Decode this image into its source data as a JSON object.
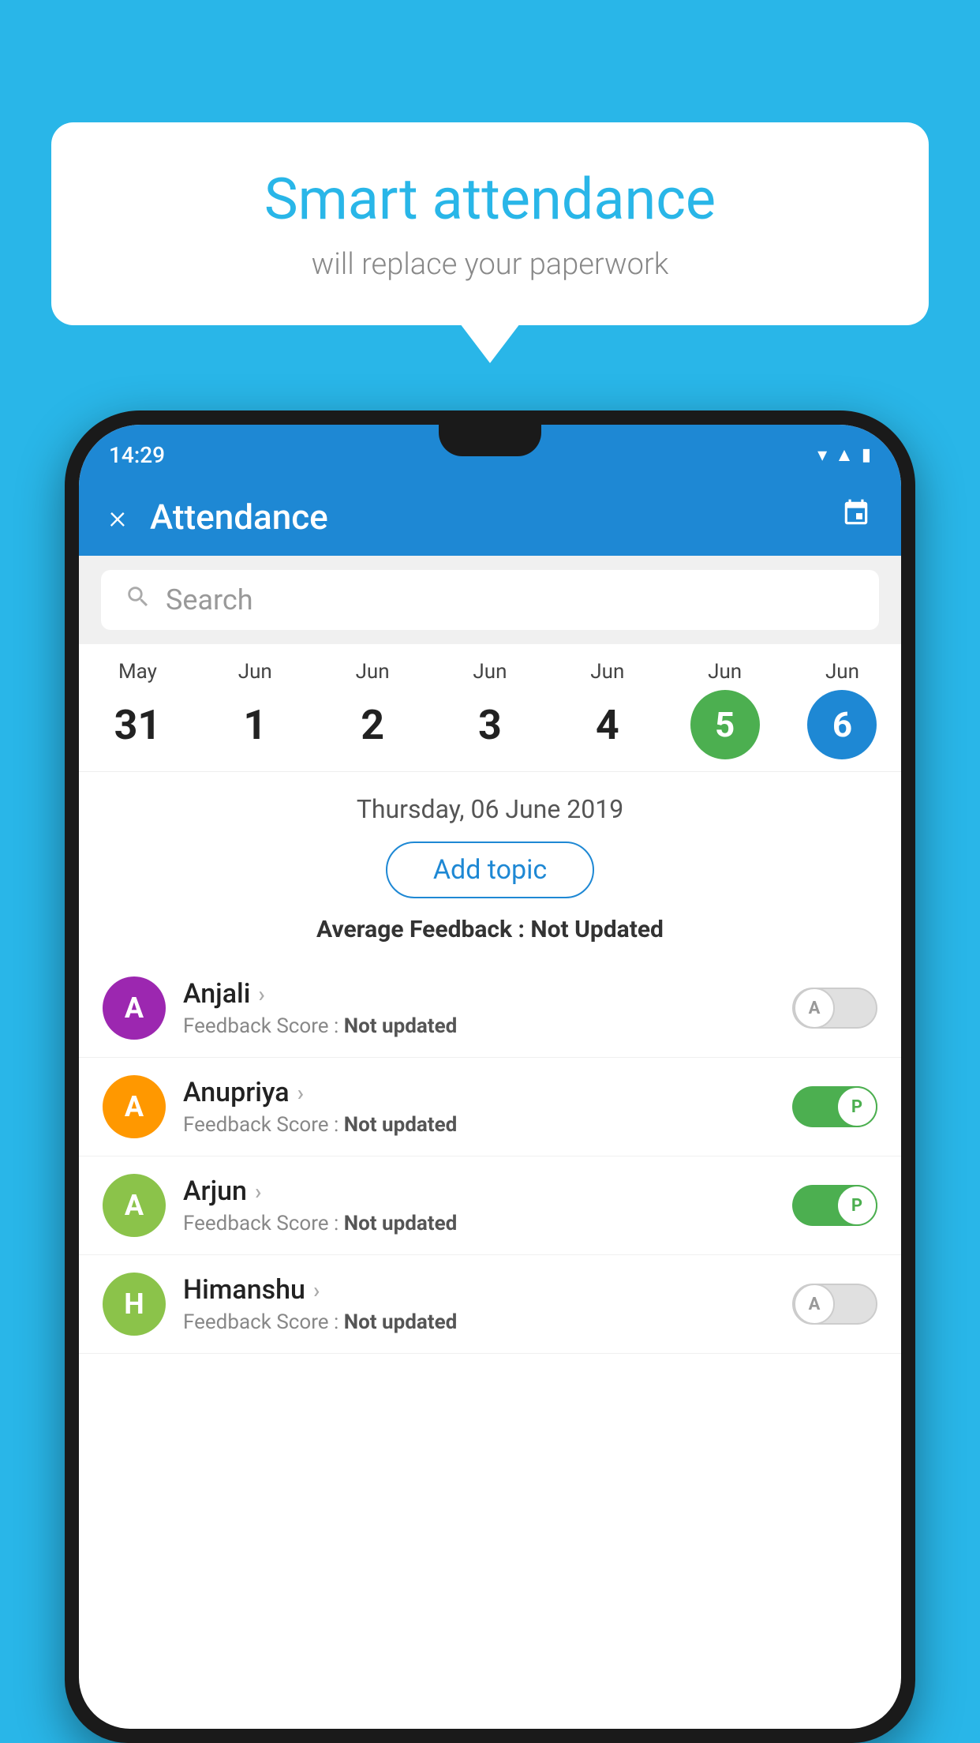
{
  "background": {
    "color": "#29b6e8"
  },
  "speech_bubble": {
    "title": "Smart attendance",
    "subtitle": "will replace your paperwork"
  },
  "status_bar": {
    "time": "14:29",
    "icons": [
      "wifi",
      "signal",
      "battery"
    ]
  },
  "app_bar": {
    "title": "Attendance",
    "close_label": "×",
    "calendar_icon": "📅"
  },
  "search": {
    "placeholder": "Search"
  },
  "calendar": {
    "days": [
      {
        "month": "May",
        "day": "31",
        "state": "normal"
      },
      {
        "month": "Jun",
        "day": "1",
        "state": "normal"
      },
      {
        "month": "Jun",
        "day": "2",
        "state": "normal"
      },
      {
        "month": "Jun",
        "day": "3",
        "state": "normal"
      },
      {
        "month": "Jun",
        "day": "4",
        "state": "normal"
      },
      {
        "month": "Jun",
        "day": "5",
        "state": "today"
      },
      {
        "month": "Jun",
        "day": "6",
        "state": "selected"
      }
    ]
  },
  "date_info": {
    "label": "Thursday, 06 June 2019",
    "add_topic_button": "Add topic",
    "avg_feedback_label": "Average Feedback : ",
    "avg_feedback_value": "Not Updated"
  },
  "students": [
    {
      "name": "Anjali",
      "avatar_letter": "A",
      "avatar_color": "purple",
      "feedback": "Feedback Score : ",
      "feedback_value": "Not updated",
      "status": "absent",
      "toggle_letter": "A"
    },
    {
      "name": "Anupriya",
      "avatar_letter": "A",
      "avatar_color": "orange",
      "feedback": "Feedback Score : ",
      "feedback_value": "Not updated",
      "status": "present",
      "toggle_letter": "P"
    },
    {
      "name": "Arjun",
      "avatar_letter": "A",
      "avatar_color": "green",
      "feedback": "Feedback Score : ",
      "feedback_value": "Not updated",
      "status": "present",
      "toggle_letter": "P"
    },
    {
      "name": "Himanshu",
      "avatar_letter": "H",
      "avatar_color": "light-green",
      "feedback": "Feedback Score : ",
      "feedback_value": "Not updated",
      "status": "absent",
      "toggle_letter": "A"
    }
  ],
  "colors": {
    "primary": "#1e88d4",
    "green": "#4caf50",
    "background": "#29b6e8"
  }
}
